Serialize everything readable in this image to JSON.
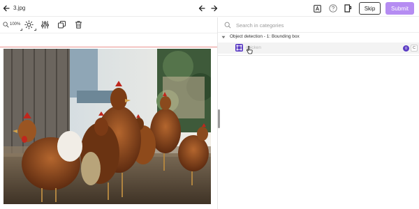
{
  "header": {
    "filename": "3.jpg",
    "skip_label": "Skip",
    "submit_label": "Submit",
    "submit_color": "#b58cf2"
  },
  "icons": {
    "back": "arrow-left-icon",
    "prev": "arrow-left-icon",
    "next": "arrow-right-icon",
    "annotations": "annotation-box-icon",
    "help": "help-circle-icon",
    "notes": "notes-icon",
    "zoom": "zoom-icon",
    "brightness": "brightness-icon",
    "adjust": "sliders-icon",
    "duplicate": "duplicate-icon",
    "delete": "trash-icon",
    "search": "search-icon",
    "bounding_box": "bounding-box-icon"
  },
  "toolbar": {
    "zoom_label": "100%"
  },
  "sidebar": {
    "search_placeholder": "Search in categories",
    "group": {
      "label": "Object detection - 1: Bounding box",
      "expanded": true
    },
    "labels": [
      {
        "name": "chicken",
        "count": "0",
        "hotkey": "C",
        "accent": "#5b3cc4"
      }
    ]
  },
  "colors": {
    "accent": "#5b3cc4",
    "divider_red": "#e8908d"
  }
}
